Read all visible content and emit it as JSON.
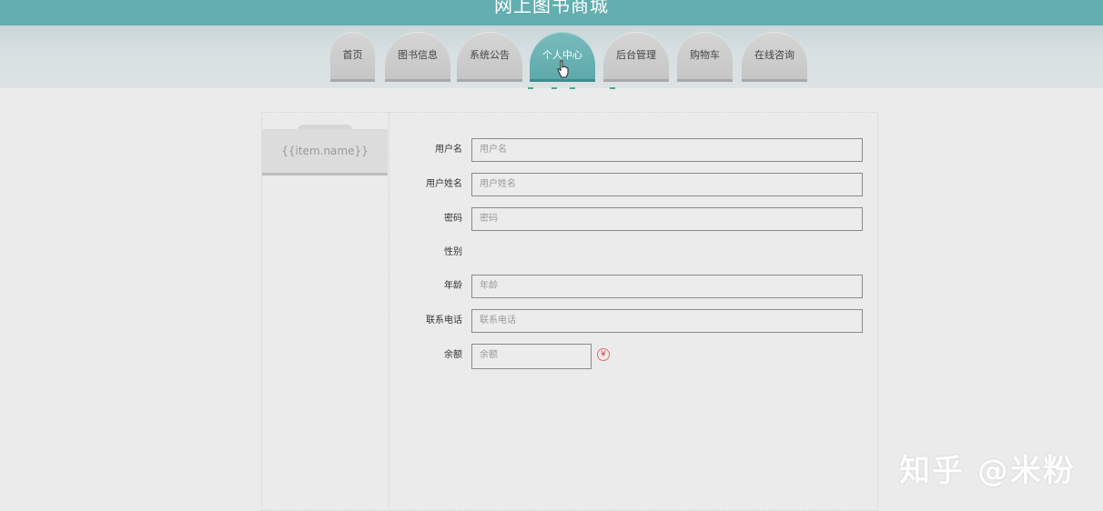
{
  "header": {
    "site_title": "网上图书商城"
  },
  "nav": {
    "tabs": [
      {
        "label": "首页",
        "active": false
      },
      {
        "label": "图书信息",
        "active": false
      },
      {
        "label": "系统公告",
        "active": false
      },
      {
        "label": "个人中心",
        "active": true
      },
      {
        "label": "后台管理",
        "active": false
      },
      {
        "label": "购物车",
        "active": false
      },
      {
        "label": "在线咨询",
        "active": false
      }
    ]
  },
  "sidebar": {
    "items": [
      {
        "label": "{{item.name}}"
      }
    ]
  },
  "form": {
    "fields": [
      {
        "label": "用户名",
        "type": "input",
        "placeholder": "用户名",
        "value": ""
      },
      {
        "label": "用户姓名",
        "type": "input",
        "placeholder": "用户姓名",
        "value": ""
      },
      {
        "label": "密码",
        "type": "input",
        "placeholder": "密码",
        "value": ""
      },
      {
        "label": "性别",
        "type": "select",
        "value": ""
      },
      {
        "label": "年龄",
        "type": "input",
        "placeholder": "年龄",
        "value": ""
      },
      {
        "label": "联系电话",
        "type": "input",
        "placeholder": "联系电话",
        "value": ""
      },
      {
        "label": "余额",
        "type": "input",
        "placeholder": "余额",
        "value": ""
      }
    ],
    "balance_icon": "yen-icon",
    "balance_symbol": "¥"
  },
  "watermark": {
    "text": "知乎 @米粉"
  },
  "colors": {
    "accent": "#62aeb0",
    "active_tab": "#5fa9ab"
  }
}
